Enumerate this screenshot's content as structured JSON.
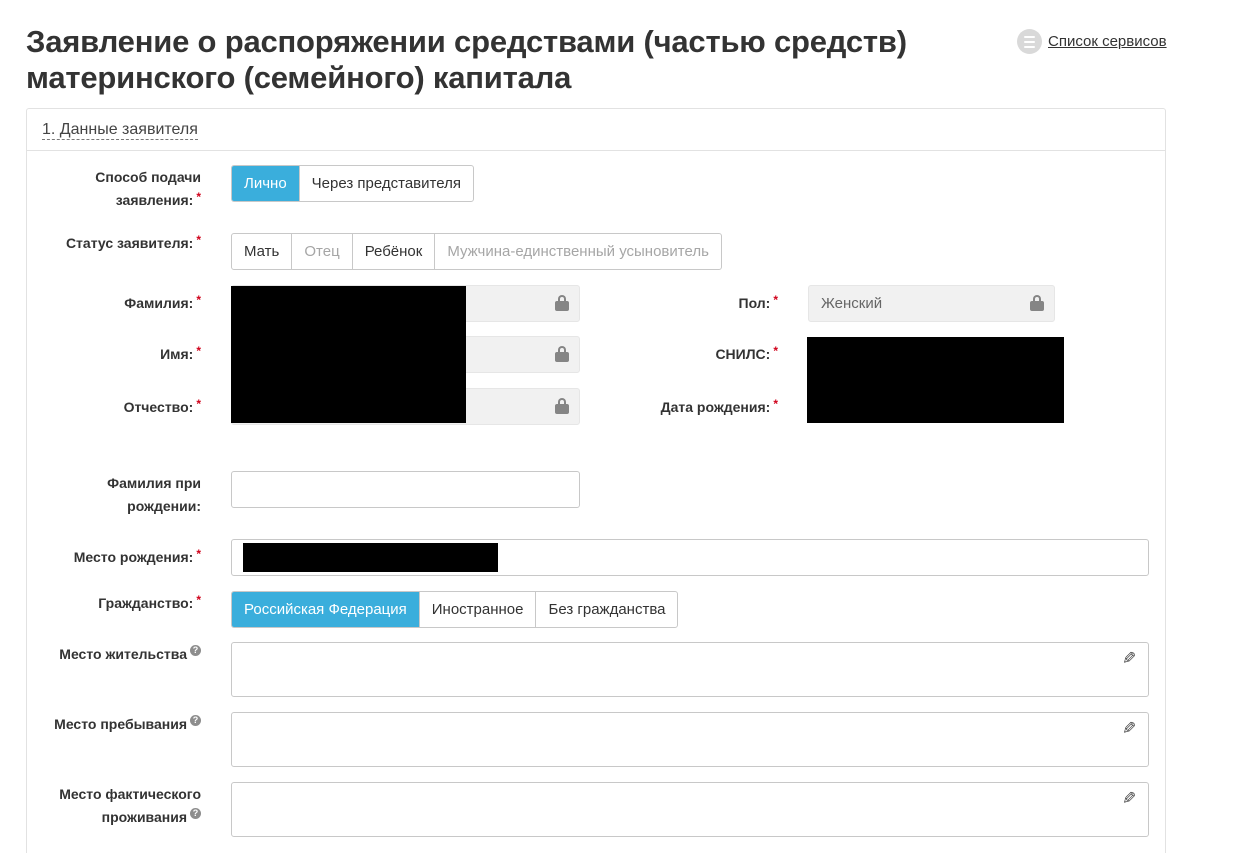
{
  "page": {
    "title": "Заявление о распоряжении средствами (частью средств) материнского (семейного) капитала",
    "services_link": "Список сервисов"
  },
  "section": {
    "title": "1. Данные заявителя"
  },
  "submission": {
    "label": "Способ подачи заявления:",
    "options": [
      "Лично",
      "Через представителя"
    ],
    "selected": "Лично"
  },
  "status": {
    "label": "Статус заявителя:",
    "options": [
      "Мать",
      "Отец",
      "Ребёнок",
      "Мужчина-единственный усыновитель"
    ],
    "disabled": [
      "Отец",
      "Мужчина-единственный усыновитель"
    ]
  },
  "fields": {
    "surname_label": "Фамилия:",
    "name_label": "Имя:",
    "patronymic_label": "Отчество:",
    "gender_label": "Пол:",
    "gender_value": "Женский",
    "snils_label": "СНИЛС:",
    "birthdate_label": "Дата рождения:",
    "birth_surname_label": "Фамилия при рождении:",
    "birth_surname_value": "",
    "birthplace_label": "Место рождения:"
  },
  "citizenship": {
    "label": "Гражданство:",
    "options": [
      "Российская Федерация",
      "Иностранное",
      "Без гражданства"
    ],
    "selected": "Российская Федерация"
  },
  "addresses": {
    "residence_label": "Место жительства",
    "stay_label": "Место пребывания",
    "actual_label": "Место фактического проживания"
  },
  "icons": {
    "services": "list-icon",
    "lock": "lock-icon",
    "edit": "pencil-icon",
    "help": "question-icon"
  },
  "colors": {
    "accent": "#3aaedc",
    "required": "#d0021b",
    "locked_bg": "#f1f1f1"
  }
}
